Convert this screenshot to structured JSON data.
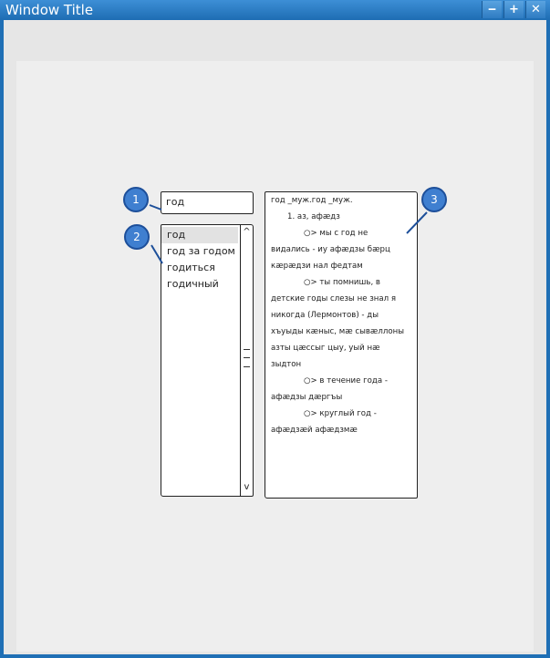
{
  "window": {
    "title": "Window Title",
    "minimize_label": "‒",
    "maximize_label": "+",
    "close_label": "✕"
  },
  "search": {
    "value": "год"
  },
  "list": {
    "items": [
      {
        "label": "год",
        "selected": true
      },
      {
        "label": "год за годом",
        "selected": false
      },
      {
        "label": "годиться",
        "selected": false
      },
      {
        "label": "годичный",
        "selected": false
      }
    ],
    "scroll_up": "^",
    "scroll_down": "v"
  },
  "definition": {
    "lines": [
      "год _муж.год  _муж.",
      "1. аз, афӕдз",
      "○> мы с год не",
      "видались - иу афӕдзы бӕрц",
      "кӕрӕдзи нал федтам",
      "○> ты помнишь, в",
      "детские годы слезы не знал я",
      "никогда (Лермонтов) - ды",
      "хъуыды кӕныс, мӕ сывӕллоны",
      "азты цӕссыг цыу, уый нӕ",
      "зыдтон",
      "○> в течение года -",
      "афӕдзы дӕргъы",
      "○> круглый год -",
      "афӕдзӕй афӕдзмӕ"
    ]
  },
  "callouts": [
    "1",
    "2",
    "3"
  ],
  "colors": {
    "titlebar": "#1e6db3",
    "callout_fill": "#3f7fd0",
    "canvas": "#eeeeee"
  }
}
